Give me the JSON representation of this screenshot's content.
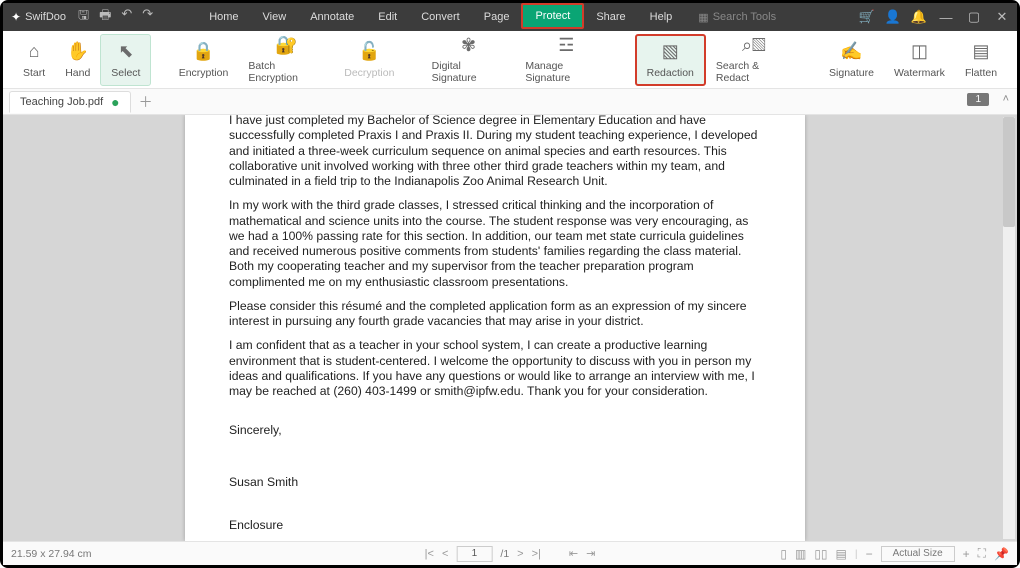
{
  "brand": "SwifDoo",
  "menus": [
    "Home",
    "View",
    "Annotate",
    "Edit",
    "Convert",
    "Page",
    "Protect",
    "Share",
    "Help"
  ],
  "active_menu": "Protect",
  "search_tools": "Search Tools",
  "ribbon": {
    "start": "Start",
    "hand": "Hand",
    "select": "Select",
    "encryption": "Encryption",
    "batch_encryption": "Batch Encryption",
    "decryption": "Decryption",
    "digital_signature": "Digital Signature",
    "manage_signature": "Manage Signature",
    "redaction": "Redaction",
    "search_redact": "Search & Redact",
    "signature": "Signature",
    "watermark": "Watermark",
    "flatten": "Flatten"
  },
  "tab": {
    "filename": "Teaching Job.pdf"
  },
  "page_badge": "1",
  "doc": {
    "p1": "I have just completed my Bachelor of Science degree in Elementary Education and have successfully completed Praxis I and Praxis II. During my student teaching experience, I developed and initiated a three-week curriculum sequence on animal species and earth resources. This collaborative unit involved working with three other third grade teachers within my team, and culminated in a field trip to the Indianapolis Zoo Animal Research Unit.",
    "p2": "In my work with the third grade classes, I stressed critical thinking and the incorporation of mathematical and science units into the course.  The student response was very encouraging, as we had a 100% passing rate for this section.  In addition, our team met state curricula guidelines and received numerous positive comments from students' families regarding the class material. Both my cooperating teacher and my supervisor from the teacher preparation program complimented me on my enthusiastic classroom presentations.",
    "p3": "Please consider this résumé and the completed application form as an expression of my sincere interest in pursuing any fourth grade vacancies that may arise in your district.",
    "p4": "I am confident that as a teacher in your school system, I can create a productive learning environment that is student-centered. I welcome the opportunity to discuss with you in person my ideas and qualifications. If you have any questions or would like to arrange an interview with me, I may be reached at (260) 403-1499 or smith@ipfw.edu. Thank you for your consideration.",
    "closing": "Sincerely,",
    "name": "Susan Smith",
    "enclosure": "Enclosure"
  },
  "status": {
    "dims": "21.59 x 27.94 cm",
    "page_current": "1",
    "page_total": "/1",
    "zoom_label": "Actual Size"
  }
}
